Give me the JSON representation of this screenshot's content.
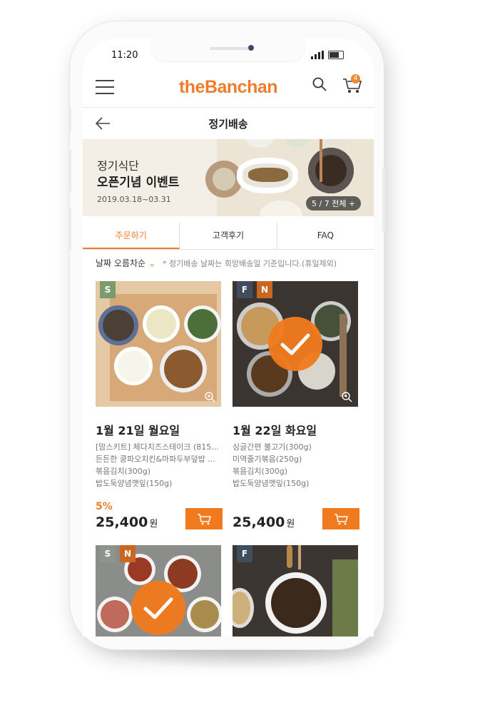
{
  "status": {
    "time": "11:20"
  },
  "header": {
    "logo": "theBanchan",
    "cart_count": "4"
  },
  "subheader": {
    "title": "정기배송"
  },
  "banner": {
    "line1": "정기식단",
    "line2": "오픈기념 이벤트",
    "date": "2019.03.18~03.31",
    "counter": "5 / 7  전체 +"
  },
  "tabs": [
    {
      "label": "주문하기",
      "active": true
    },
    {
      "label": "고객후기",
      "active": false
    },
    {
      "label": "FAQ",
      "active": false
    }
  ],
  "sort": {
    "label": "날짜 오름차순",
    "note": "* 정기배송 날짜는 희망배송일 기준입니다.(휴일제외)"
  },
  "products": [
    {
      "tags": [
        "S"
      ],
      "date": "1월 21일 월요일",
      "items": [
        "[맘스키트] 체다치즈스테이크 (815...",
        "든든한 쿵파오치킨&마파두부덮밥 ...",
        "볶음김치(300g)",
        "밥도둑양념깻잎(150g)"
      ],
      "discount": "5%",
      "price": "25,400",
      "unit": "원",
      "selected": false
    },
    {
      "tags": [
        "F",
        "N"
      ],
      "date": "1월 22일 화요일",
      "items": [
        "싱글간편 불고기(300g)",
        "미역줄기볶음(250g)",
        "볶음김치(300g)",
        "밥도둑양념깻잎(150g)"
      ],
      "discount": "",
      "price": "25,400",
      "unit": "원",
      "selected": true
    },
    {
      "tags": [
        "S",
        "N"
      ],
      "selected": true
    },
    {
      "tags": [
        "F"
      ],
      "selected": false
    }
  ],
  "colors": {
    "accent": "#ef7d2c",
    "check": "#f07a1d"
  }
}
